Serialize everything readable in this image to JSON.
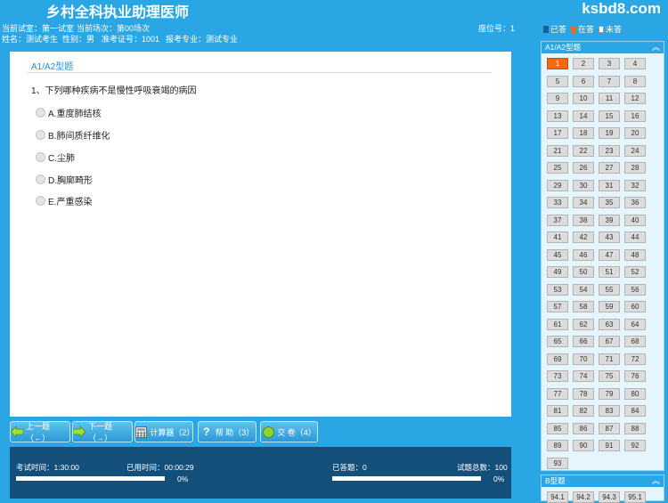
{
  "header": {
    "app_title": "乡村全科执业助理医师",
    "site": "ksbd8.com"
  },
  "info": {
    "room": "当前试室：第一试室",
    "session": "当前场次：第00场次",
    "seat": "座位号：1",
    "name": "姓名：测试考生",
    "gender": "性别：男",
    "ticket": "准考证号：1001",
    "major": "报考专业：测试专业"
  },
  "question": {
    "section": "A1/A2型题",
    "text": "1、下列哪种疾病不是慢性呼吸衰竭的病因",
    "options": [
      "A.重度肺结核",
      "B.肺间质纤维化",
      "C.尘肺",
      "D.胸廓畸形",
      "E.严重感染"
    ]
  },
  "toolbar": {
    "prev": "上一题（←）",
    "next": "下一题（→）",
    "calc": "计算器（2）",
    "help": "帮  助（3）",
    "submit": "交  卷（4）"
  },
  "status": {
    "total_time": "考试时间：1:30:00",
    "used_time": "已用时间：00:00:29",
    "answered": "已答题：0",
    "total_questions": "试题总数：100",
    "time_percent": "0%",
    "answer_percent": "0%",
    "time_progress": 0,
    "answer_progress": 0
  },
  "sidebar": {
    "legend": {
      "answered": "已答",
      "current": "在答",
      "unanswered": "未答"
    },
    "legend_colors": {
      "answered": "#1a5f96",
      "current": "#f06a12",
      "unanswered": "#ffffff"
    },
    "panel_a_title": "A1/A2型题",
    "panel_b_title": "B型题",
    "current_question": "1",
    "a_questions": [
      "1",
      "2",
      "3",
      "4",
      "5",
      "6",
      "7",
      "8",
      "9",
      "10",
      "11",
      "12",
      "13",
      "14",
      "15",
      "16",
      "17",
      "18",
      "19",
      "20",
      "21",
      "22",
      "23",
      "24",
      "25",
      "26",
      "27",
      "28",
      "29",
      "30",
      "31",
      "32",
      "33",
      "34",
      "35",
      "36",
      "37",
      "38",
      "39",
      "40",
      "41",
      "42",
      "43",
      "44",
      "45",
      "46",
      "47",
      "48",
      "49",
      "50",
      "51",
      "52",
      "53",
      "54",
      "55",
      "56",
      "57",
      "58",
      "59",
      "60",
      "61",
      "62",
      "63",
      "64",
      "65",
      "66",
      "67",
      "68",
      "69",
      "70",
      "71",
      "72",
      "73",
      "74",
      "75",
      "76",
      "77",
      "78",
      "79",
      "80",
      "81",
      "82",
      "83",
      "84",
      "85",
      "86",
      "87",
      "88",
      "89",
      "90",
      "91",
      "92",
      "93"
    ],
    "b_questions": [
      "94.1",
      "94.2",
      "94.3",
      "95.1"
    ]
  }
}
